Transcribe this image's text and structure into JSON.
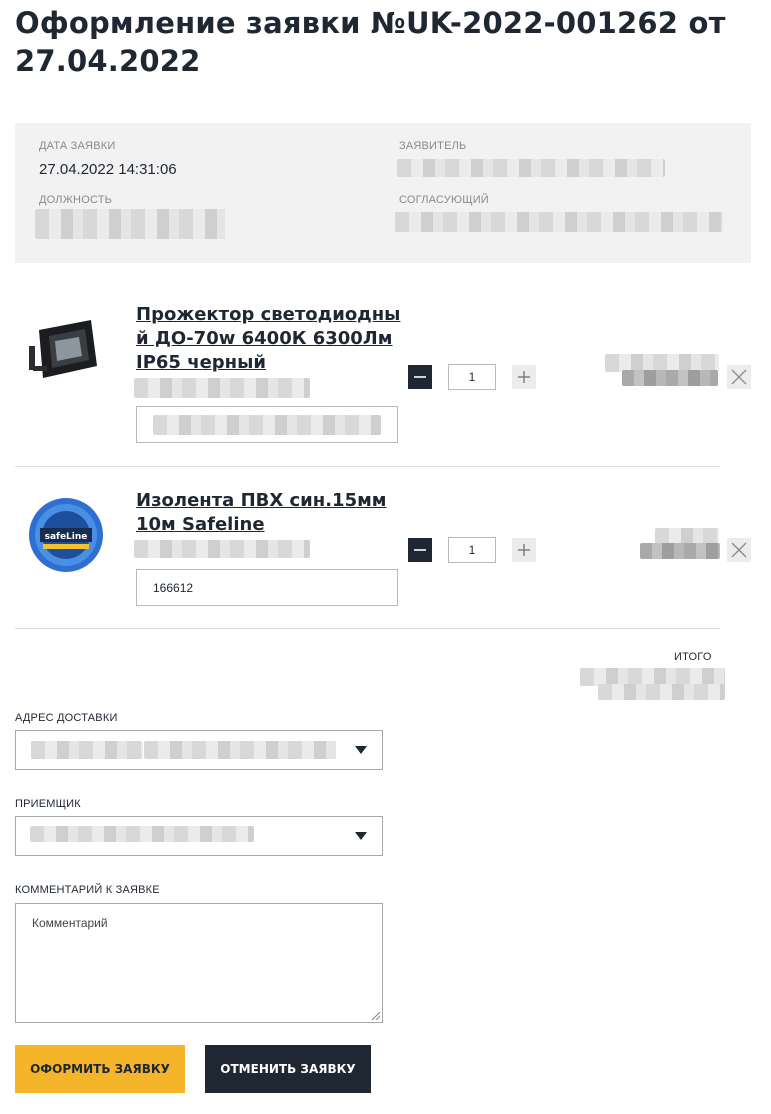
{
  "title": "Оформление заявки №UK-2022-001262 от 27.04.2022",
  "info": {
    "date_label": "ДАТА ЗАЯВКИ",
    "date_value": "27.04.2022 14:31:06",
    "applicant_label": "ЗАЯВИТЕЛЬ",
    "position_label": "ДОЛЖНОСТЬ",
    "approver_label": "СОГЛАСУЮЩИЙ"
  },
  "items": [
    {
      "name": "Прожектор светодиодный ДО-70w 6400К 6300Лм IP65 черный",
      "quantity": "1",
      "code": "",
      "image": "floodlight-image"
    },
    {
      "name": "Изолента ПВХ син.15мм 10м Safeline",
      "quantity": "1",
      "code": "166612",
      "image": "insulating-tape-image",
      "brand_text": "safeLine"
    }
  ],
  "total_label": "ИТОГО",
  "delivery": {
    "label": "АДРЕС ДОСТАВКИ"
  },
  "receiver": {
    "label": "ПРИЕМЩИК"
  },
  "comment": {
    "label": "КОММЕНТАРИЙ К ЗАЯВКЕ",
    "placeholder": "Комментарий"
  },
  "buttons": {
    "submit": "ОФОРМИТЬ ЗАЯВКУ",
    "cancel": "ОТМЕНИТЬ ЗАЯВКУ"
  },
  "colors": {
    "accent": "#f5b52a",
    "dark": "#1f2732",
    "panel": "#f2f2f2"
  }
}
